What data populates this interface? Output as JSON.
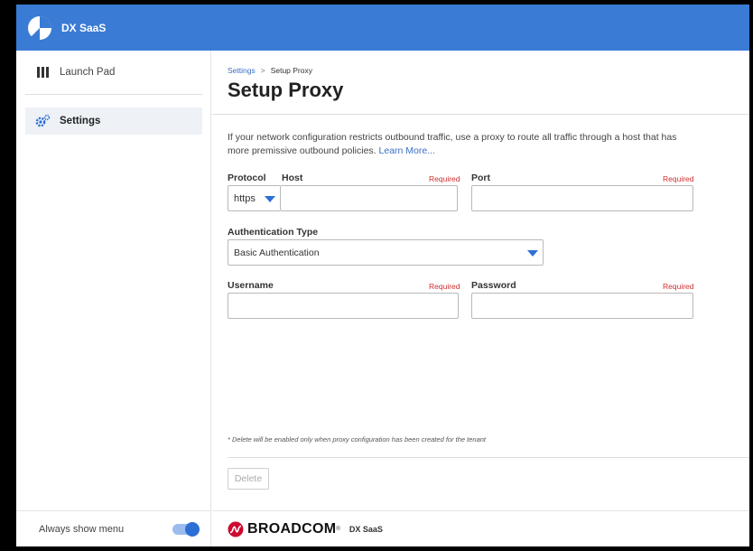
{
  "header": {
    "app_name": "DX SaaS"
  },
  "sidebar": {
    "items": [
      {
        "label": "Launch Pad"
      },
      {
        "label": "Settings"
      }
    ],
    "footer_label": "Always show menu",
    "always_show_menu": true
  },
  "breadcrumb": {
    "parent": "Settings",
    "separator": ">",
    "current": "Setup Proxy"
  },
  "page": {
    "title": "Setup Proxy",
    "description": "If your network configuration restricts outbound traffic, use a proxy to route all traffic through a host that has more premissive outbound policies.",
    "learn_more": "Learn More..."
  },
  "form": {
    "protocol_label": "Protocol",
    "protocol_value": "https",
    "host_label": "Host",
    "host_required": "Required",
    "host_value": "",
    "port_label": "Port",
    "port_required": "Required",
    "port_value": "",
    "auth_label": "Authentication Type",
    "auth_value": "Basic Authentication",
    "username_label": "Username",
    "username_required": "Required",
    "username_value": "",
    "password_label": "Password",
    "password_required": "Required",
    "password_value": ""
  },
  "note": "* Delete will be enabled only when proxy configuration has been created for the tenant",
  "actions": {
    "delete_label": "Delete"
  },
  "footer": {
    "brand": "BROADCOM",
    "app": "DX SaaS"
  },
  "colors": {
    "header_bg": "#3a7bd5",
    "accent": "#2e6fd6",
    "required": "#d03030",
    "brand_red": "#cc092f"
  }
}
